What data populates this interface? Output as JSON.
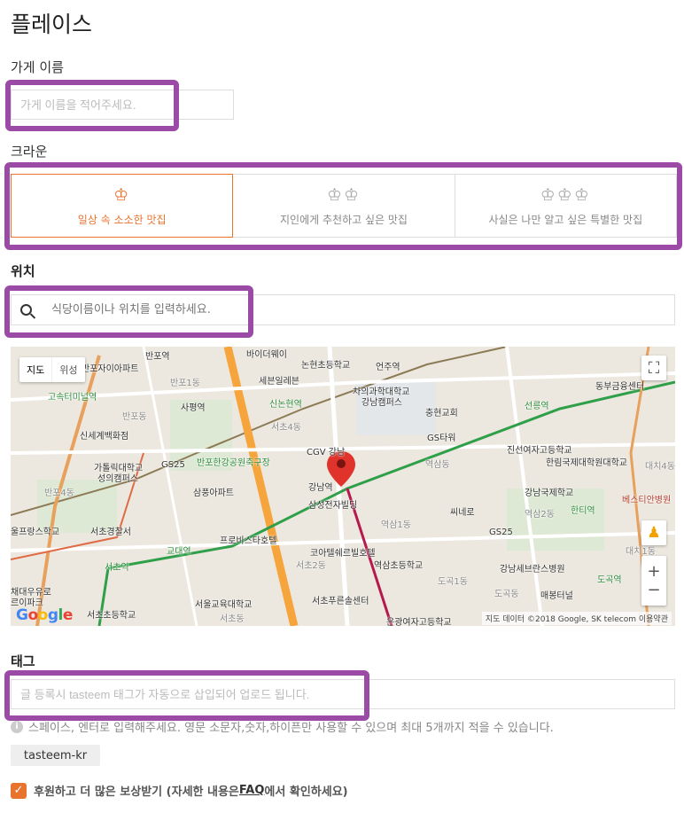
{
  "page": {
    "title": "플레이스"
  },
  "name": {
    "label": "가게 이름",
    "placeholder": "가게 이름을 적어주세요."
  },
  "crown": {
    "label": "크라운",
    "options": [
      {
        "crowns": "♔",
        "text": "일상 속 소소한 맛집",
        "active": true
      },
      {
        "crowns": "♔♔",
        "text": "지인에게 추천하고 싶은 맛집",
        "active": false
      },
      {
        "crowns": "♔♔♔",
        "text": "사실은 나만 알고 싶은 특별한 맛집",
        "active": false
      }
    ]
  },
  "location": {
    "label": "위치",
    "placeholder": "식당이름이나 위치를 입력하세요."
  },
  "map": {
    "type_map": "지도",
    "type_satellite": "위성",
    "attribution": "지도 데이터 ©2018 Google, SK telecom   이용약관",
    "logo": "Google",
    "labels": {
      "l1": "반포역",
      "l2": "바이더웨이",
      "l3": "반포자이아파트",
      "l4": "논현초등학교",
      "l5": "언주역",
      "l6": "동부금융센터",
      "l7": "고속터미널역",
      "l8": "반포1동",
      "l9": "세븐일레븐",
      "l10": "차의과학대학교",
      "l11": "강남캠퍼스",
      "l12": "사평역",
      "l13": "신논현역",
      "l14": "충현교회",
      "l15": "선릉역",
      "l16": "반포동",
      "l17": "서초4동",
      "l18": "신세계백화점",
      "l19": "GS타워",
      "l20": "CGV 강남",
      "l21": "진선여자고등학교",
      "l22": "가톨릭대학교",
      "l23": "성의캠퍼스",
      "l24": "GS25",
      "l25": "반포한강공원축구장",
      "l26": "역삼동",
      "l27": "한림국제대학원대학교",
      "l28": "대치4동",
      "l29": "강남역",
      "l30": "삼성전자빌딩",
      "l31": "강남국제학교",
      "l32": "반포4동",
      "l33": "삼풍아파트",
      "l34": "베스티안병원",
      "l35": "씨네로",
      "l36": "역삼2동",
      "l37": "한티역",
      "l38": "울프랑스학교",
      "l39": "서초경찰서",
      "l40": "역삼1동",
      "l41": "GS25",
      "l42": "프로비스타호텔",
      "l43": "교대역",
      "l44": "코아텔쉐르빌호텔",
      "l45": "대치1동",
      "l46": "서초역",
      "l47": "서초2동",
      "l48": "역삼초등학교",
      "l49": "강남세브란스병원",
      "l50": "도곡1동",
      "l51": "도곡역",
      "l52": "채대우유로",
      "l53": "르이파크",
      "l54": "서울교육대학교",
      "l55": "도곡동",
      "l56": "매봉터널",
      "l57": "서초푸른솔센터",
      "l58": "서초초등학교",
      "l59": "서초동",
      "l60": "은광여자고등학교"
    }
  },
  "tag": {
    "label": "태그",
    "placeholder": "글 등록시 tasteem 태그가 자동으로 삽입되어 업로드 됩니다.",
    "hint": "스페이스, 엔터로 입력해주세요. 영문 소문자,숫자,하이픈만 사용할 수 있으며 최대 5개까지 적을 수 있습니다.",
    "chip": "tasteem-kr"
  },
  "reward": {
    "text_before": "후원하고 더 많은 보상받기  (자세한 내용은 ",
    "faq": "FAQ",
    "text_after": "에서 확인하세요)"
  },
  "colors": {
    "accent": "#e8732f",
    "highlight": "#9b4aa6"
  }
}
